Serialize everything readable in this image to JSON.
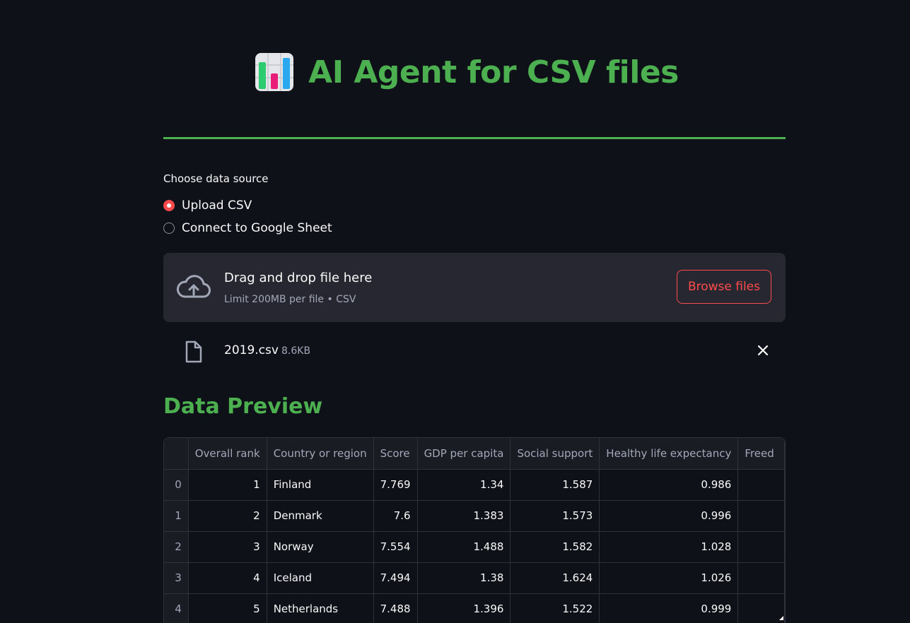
{
  "header": {
    "title": "AI Agent for CSV files",
    "icon": "bar-chart-icon"
  },
  "data_source": {
    "label": "Choose data source",
    "options": [
      {
        "label": "Upload CSV",
        "selected": true
      },
      {
        "label": "Connect to Google Sheet",
        "selected": false
      }
    ]
  },
  "uploader": {
    "title": "Drag and drop file here",
    "subtitle": "Limit 200MB per file • CSV",
    "button_label": "Browse files",
    "icon": "cloud-upload-icon"
  },
  "uploaded_file": {
    "name": "2019.csv",
    "size": "8.6KB",
    "icon": "file-icon",
    "remove_icon": "close-icon"
  },
  "preview": {
    "title": "Data Preview",
    "columns": [
      "",
      "Overall rank",
      "Country or region",
      "Score",
      "GDP per capita",
      "Social support",
      "Healthy life expectancy",
      "Freed"
    ],
    "rows": [
      [
        "0",
        "1",
        "Finland",
        "7.769",
        "1.34",
        "1.587",
        "0.986",
        ""
      ],
      [
        "1",
        "2",
        "Denmark",
        "7.6",
        "1.383",
        "1.573",
        "0.996",
        ""
      ],
      [
        "2",
        "3",
        "Norway",
        "7.554",
        "1.488",
        "1.582",
        "1.028",
        ""
      ],
      [
        "3",
        "4",
        "Iceland",
        "7.494",
        "1.38",
        "1.624",
        "1.026",
        ""
      ],
      [
        "4",
        "5",
        "Netherlands",
        "7.488",
        "1.396",
        "1.522",
        "0.999",
        ""
      ]
    ]
  },
  "colors": {
    "background": "#0e1117",
    "accent_green": "#4caf50",
    "accent_red": "#ff4b4b",
    "panel": "#262730"
  }
}
